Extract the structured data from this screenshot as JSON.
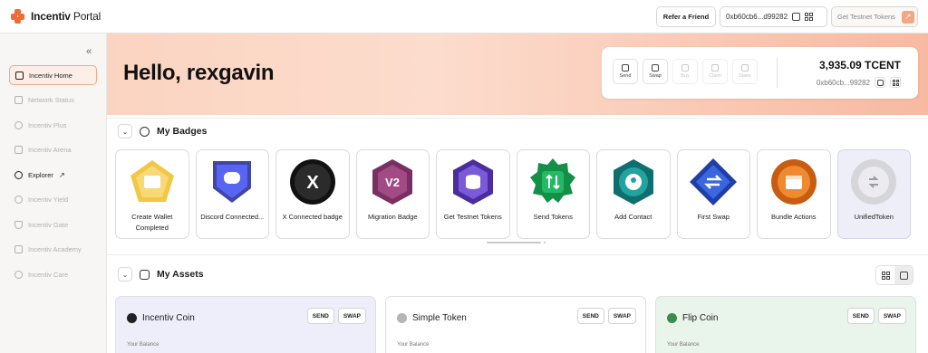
{
  "app": {
    "logo_bold": "Incentiv",
    "logo_light": " Portal"
  },
  "topbar": {
    "refer_label": "Refer a Friend",
    "wallet_address": "0xb60cb6...d99282",
    "testnet_label": "Get Testnet Tokens"
  },
  "sidebar": {
    "collapse_glyph": "«",
    "items": [
      {
        "label": "Incentiv Home"
      },
      {
        "label": "Network Status"
      },
      {
        "label": "Incentiv Plus"
      },
      {
        "label": "Incentiv Arena"
      },
      {
        "label": "Explorer"
      },
      {
        "label": "Incentiv Yield"
      },
      {
        "label": "Incentiv Gate"
      },
      {
        "label": "Incentiv Academy"
      },
      {
        "label": "Incentiv Care"
      }
    ]
  },
  "hero": {
    "greeting": "Hello, rexgavin",
    "actions": [
      "Send",
      "Swap",
      "Buy",
      "Claim",
      "Stake"
    ],
    "balance": "3,935.09 TCENT",
    "address": "0xb60cb...99282"
  },
  "badges": {
    "title": "My Badges",
    "items": [
      {
        "label": "Create Wallet Completed",
        "color": "#f2c744"
      },
      {
        "label": "Discord Connected...",
        "color": "#5865f2"
      },
      {
        "label": "X Connected badge",
        "color": "#222222",
        "glyph": "X"
      },
      {
        "label": "Migration Badge",
        "color": "#8e3c72",
        "glyph": "V2"
      },
      {
        "label": "Get Testnet Tokens",
        "color": "#6a45c9"
      },
      {
        "label": "Send Tokens",
        "color": "#1aa55a"
      },
      {
        "label": "Add Contact",
        "color": "#1c8c8c"
      },
      {
        "label": "First Swap",
        "color": "#2950c8"
      },
      {
        "label": "Bundle Actions",
        "color": "#d9731f"
      },
      {
        "label": "UnifiedToken",
        "color": "#d7d7dd"
      }
    ]
  },
  "assets": {
    "title": "My Assets",
    "send_label": "SEND",
    "swap_label": "SWAP",
    "balance_label": "Your Balance",
    "items": [
      {
        "name": "Incentiv Coin",
        "bg": "#eeeefa",
        "icon_color": "#222222"
      },
      {
        "name": "Simple Token",
        "bg": "#ffffff",
        "icon_color": "#9a9a9a"
      },
      {
        "name": "Flip Coin",
        "bg": "#e9f4ea",
        "icon_color": "#3c8c4a"
      }
    ]
  }
}
